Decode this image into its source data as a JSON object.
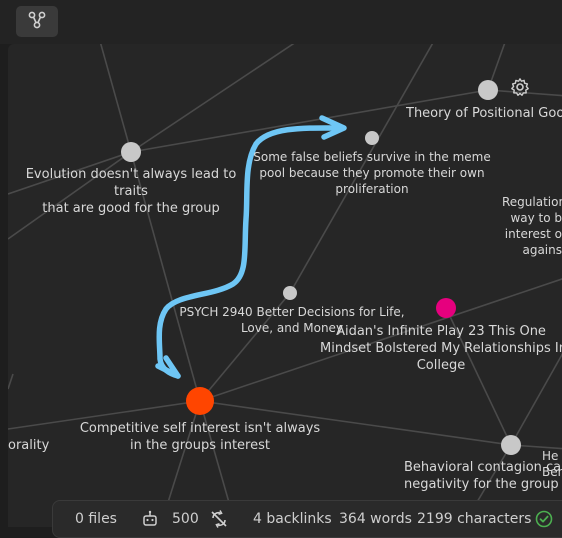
{
  "toolbar": {
    "graph_view_button": "graph-icon"
  },
  "graph": {
    "nodes": [
      {
        "id": "evolution",
        "label": "Evolution doesn't always lead to traits\nthat are good for the group",
        "color": "#bdbdbd"
      },
      {
        "id": "false-beliefs",
        "label": "Some false beliefs survive in the meme\npool because they promote their own\nproliferation",
        "color": "#bdbdbd"
      },
      {
        "id": "positional",
        "label": "Theory of Positional Goo",
        "color": "#bdbdbd"
      },
      {
        "id": "regulation",
        "label": "Regulation\nway to b\ninterest o\nagains",
        "color": "#bdbdbd"
      },
      {
        "id": "psych2940",
        "label": "PSYCH 2940 Better Decisions for Life,\nLove, and Money",
        "color": "#bdbdbd"
      },
      {
        "id": "infinite-play",
        "label": "Aidan's Infinite Play 23 This One\nMindset Bolstered My Relationships In\nCollege",
        "color": "#e6007e"
      },
      {
        "id": "competitive",
        "label": "Competitive self interest isn't always\nin the groups interest",
        "color": "#ff4500"
      },
      {
        "id": "behavioral",
        "label": "Behavioral contagion can\nnegativity for the group a",
        "color": "#bdbdbd"
      },
      {
        "id": "morality",
        "label": "orality",
        "color": "#bdbdbd"
      },
      {
        "id": "he",
        "label": "He\nBeha",
        "color": "#bdbdbd"
      }
    ],
    "annotation_arrow_color": "#6ec6f5"
  },
  "settings": {
    "icon": "gear-icon"
  },
  "status": {
    "files": "0 files",
    "sync_count": "500",
    "backlinks": "4 backlinks",
    "words": "364 words",
    "characters": "2199 characters"
  }
}
